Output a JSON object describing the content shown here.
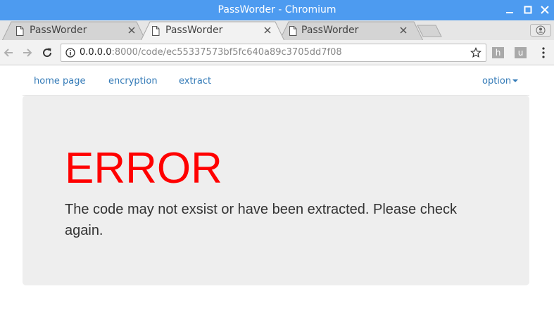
{
  "window": {
    "title": "PassWorder - Chromium"
  },
  "tabs": [
    {
      "label": "PassWorder",
      "active": false
    },
    {
      "label": "PassWorder",
      "active": true
    },
    {
      "label": "PassWorder",
      "active": false
    }
  ],
  "toolbar": {
    "url_host": "0.0.0.0",
    "url_path": ":8000/code/ec55337573bf5fc640a89c3705dd7f08",
    "extensions": [
      "h",
      "u"
    ]
  },
  "nav": {
    "links": [
      "home page",
      "encryption",
      "extract"
    ],
    "option_label": "option"
  },
  "main": {
    "heading": "ERROR",
    "message": "The code may not exsist or have been extracted. Please check again."
  },
  "colors": {
    "titlebar": "#4d9bf0",
    "link": "#337ab7",
    "error": "#ff0000",
    "jumbotron": "#eeeeee"
  },
  "icons": [
    "document-icon",
    "close-icon",
    "minimize-icon",
    "maximize-icon",
    "back-icon",
    "forward-icon",
    "reload-icon",
    "info-icon",
    "star-icon",
    "menu-icon",
    "profile-icon"
  ]
}
